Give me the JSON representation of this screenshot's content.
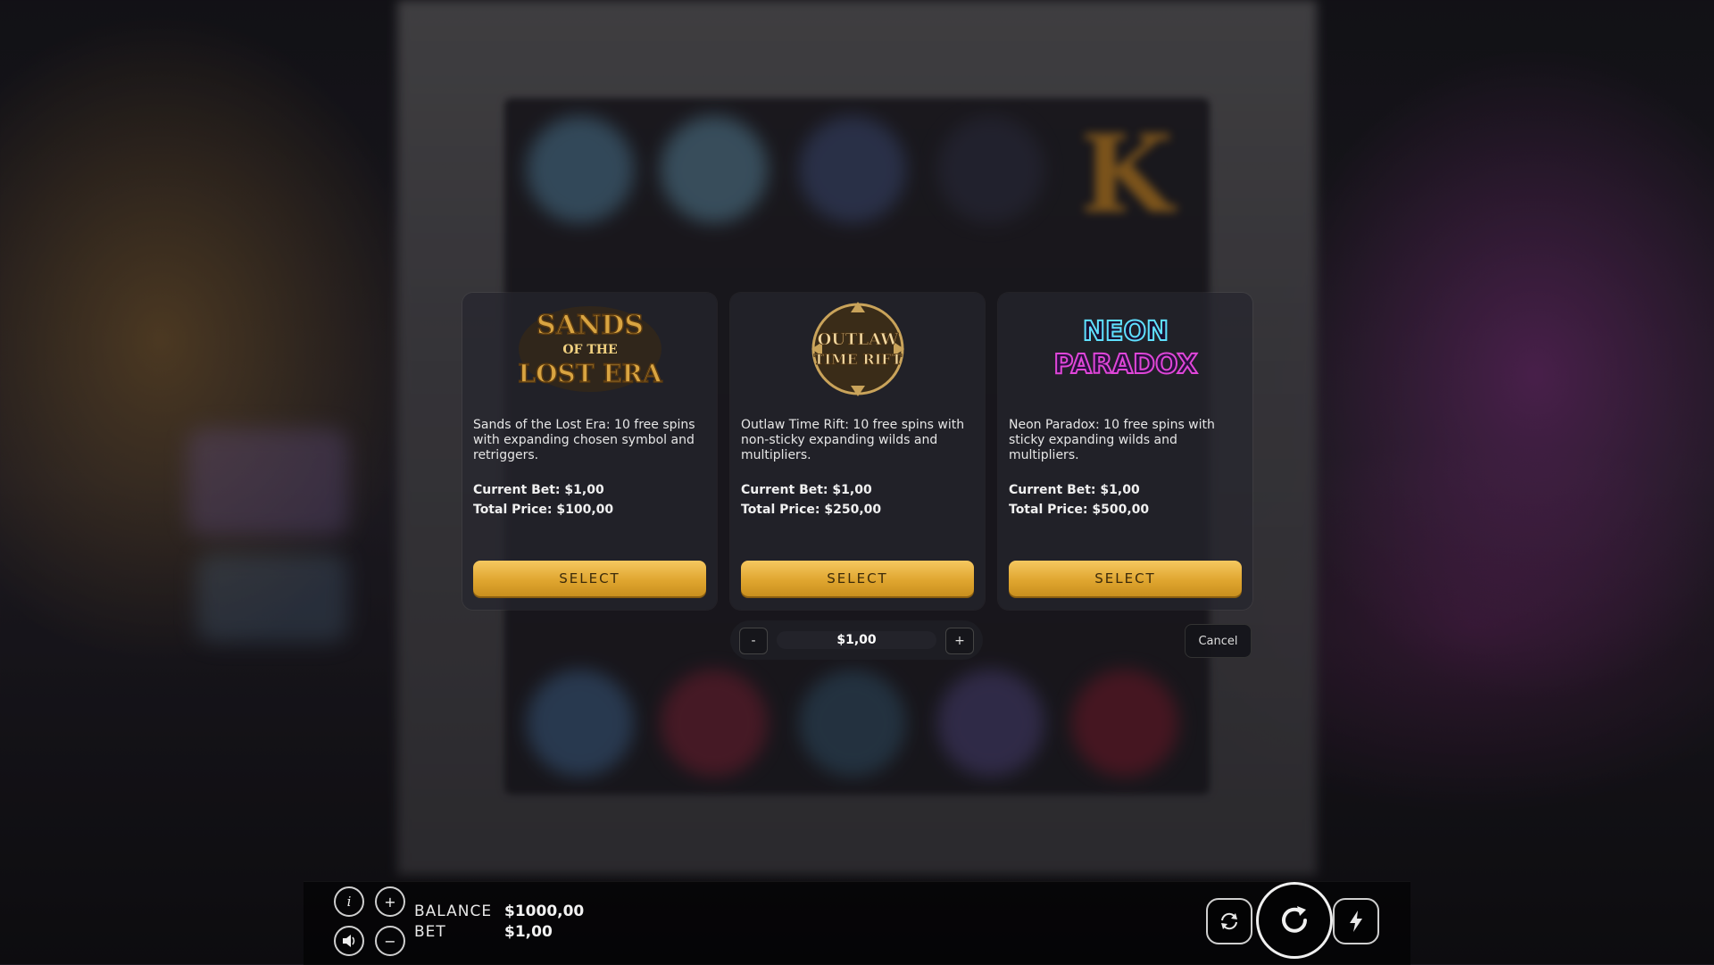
{
  "cards": [
    {
      "logo_text": [
        "SANDS",
        "OF THE",
        "LOST ERA"
      ],
      "description": "Sands of the Lost Era: 10 free spins with expanding chosen symbol and retriggers.",
      "current_bet": "Current Bet: $1,00",
      "total_price": "Total Price: $100,00",
      "select_label": "SELECT"
    },
    {
      "logo_text": [
        "OUTLAW",
        "TIME RIFT"
      ],
      "description": "Outlaw Time Rift: 10 free spins with non-sticky expanding wilds and multipliers.",
      "current_bet": "Current Bet: $1,00",
      "total_price": "Total Price: $250,00",
      "select_label": "SELECT"
    },
    {
      "logo_text": [
        "NEON",
        "PARADOX"
      ],
      "description": "Neon Paradox: 10 free spins with sticky expanding wilds and multipliers.",
      "current_bet": "Current Bet: $1,00",
      "total_price": "Total Price: $500,00",
      "select_label": "SELECT"
    }
  ],
  "stepper": {
    "minus": "-",
    "value": "$1,00",
    "plus": "+"
  },
  "cancel_label": "Cancel",
  "bottom_bar": {
    "balance_label": "BALANCE",
    "balance_value": "$1000,00",
    "bet_label": "BET",
    "bet_value": "$1,00",
    "info_glyph": "i",
    "plus_glyph": "+",
    "minus_glyph": "−"
  },
  "colors": {
    "select_gold": "#e0a630",
    "sands_gold": "#d9a441",
    "outlaw_gold": "#c9a35a",
    "neon_pink": "#e046d8",
    "neon_cyan": "#5fe0ff"
  },
  "icons": [
    "info-icon",
    "plus-icon",
    "sound-icon",
    "minus-icon",
    "autoplay-icon",
    "spin-icon",
    "turbo-icon"
  ],
  "background_letter": "K"
}
